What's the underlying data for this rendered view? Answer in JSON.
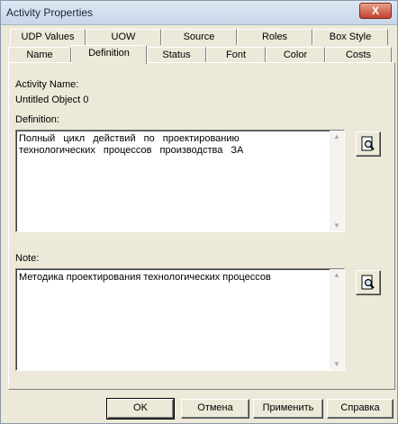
{
  "window": {
    "title": "Activity Properties",
    "close": "X"
  },
  "tabs_row1": [
    "UDP Values",
    "UOW",
    "Source",
    "Roles",
    "Box Style"
  ],
  "tabs_row2": [
    "Name",
    "Definition",
    "Status",
    "Font",
    "Color",
    "Costs"
  ],
  "active_tab": "Definition",
  "activity": {
    "name_label": "Activity Name:",
    "name_value": "Untitled Object 0"
  },
  "definition": {
    "label": "Definition:",
    "text": "Полный цикл действий по проектированию\nтехнологических процессов производства ЗА"
  },
  "note": {
    "label": "Note:",
    "text": "Методика проектирования технологических процессов"
  },
  "buttons": {
    "ok": "OK",
    "cancel": "Отмена",
    "apply": "Применить",
    "help": "Справка"
  }
}
